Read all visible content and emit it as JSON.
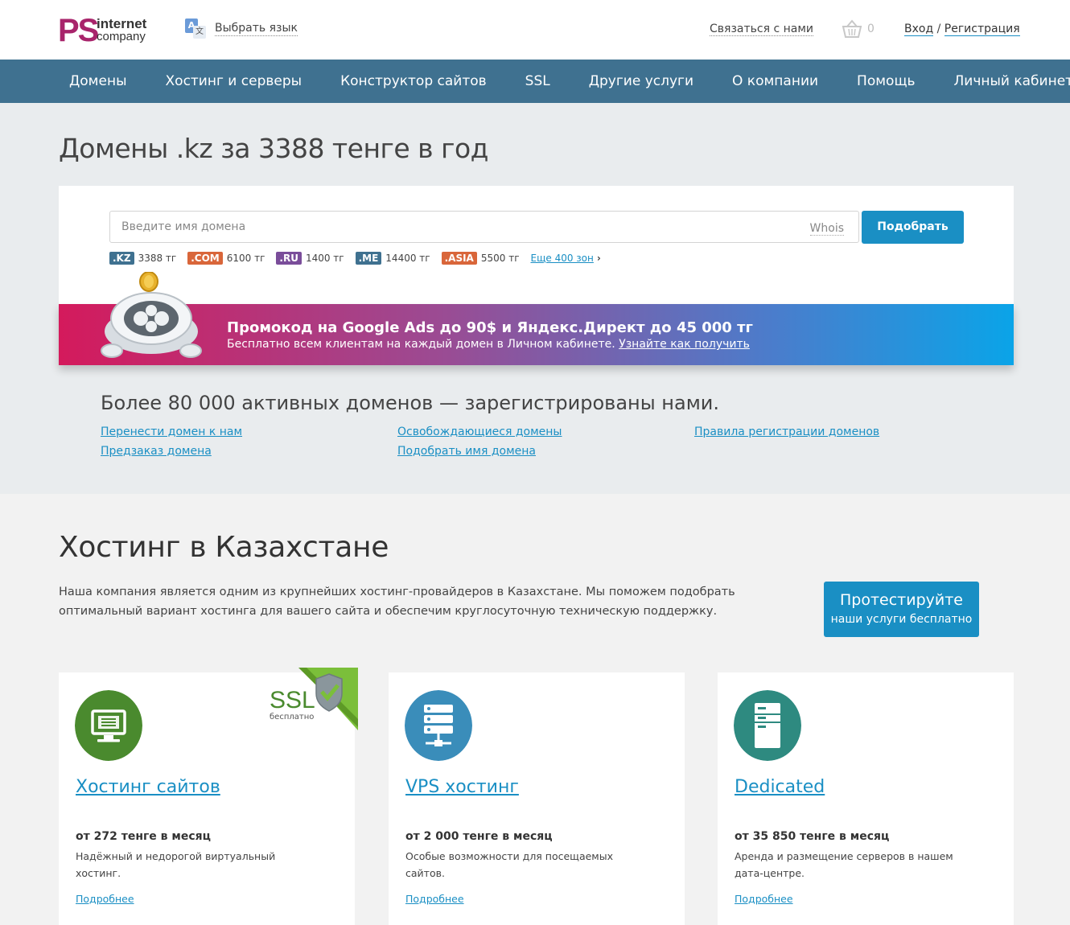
{
  "header": {
    "logo_ps": "PS",
    "logo_internet": "internet",
    "logo_company": "company",
    "language_label": "Выбрать язык",
    "contact_label": "Связаться с нами",
    "cart_count": "0",
    "login_label": "Вход",
    "auth_separator": "/",
    "register_label": "Регистрация"
  },
  "nav": {
    "items": [
      "Домены",
      "Хостинг и серверы",
      "Конструктор сайтов",
      "SSL",
      "Другие услуги",
      "О компании",
      "Помощь",
      "Личный кабинет"
    ]
  },
  "domains": {
    "title": "Домены .kz за 3388 тенге в год",
    "search_placeholder": "Введите имя домена",
    "whois_label": "Whois",
    "search_button": "Подобрать",
    "zones": [
      {
        "name": ".KZ",
        "price": "3388 тг",
        "color": "#3f7190"
      },
      {
        "name": ".COM",
        "price": "6100 тг",
        "color": "#d9663a"
      },
      {
        "name": ".RU",
        "price": "1400 тг",
        "color": "#7a4d9a"
      },
      {
        "name": ".ME",
        "price": "14400 тг",
        "color": "#3f7190"
      },
      {
        "name": ".ASIA",
        "price": "5500 тг",
        "color": "#d9663a"
      }
    ],
    "more_zones": "Еще 400 зон",
    "more_zones_arrow": "›",
    "promo_title": "Промокод на Google Ads до 90$ и Яндекс.Директ до 45 000 тг",
    "promo_text": "Бесплатно всем клиентам на каждый домен в Личном кабинете.",
    "promo_link": "Узнайте как получить",
    "count_text": "Более 80 000 активных доменов — зарегистрированы нами.",
    "links": {
      "transfer": "Перенести домен к нам",
      "preorder": "Предзаказ домена",
      "expiring": "Освобождающиеся домены",
      "pick": "Подобрать имя домена",
      "rules": "Правила регистрации доменов"
    }
  },
  "hosting": {
    "title": "Хостинг в Казахстане",
    "description": "Наша компания является одним из крупнейших хостинг-провайдеров в Казахстане. Мы поможем подобрать оптимальный вариант хостинга для вашего сайта и обеспечим круглосуточную техническую поддержку.",
    "test_button_line1": "Протестируйте",
    "test_button_line2": "наши услуги бесплатно",
    "ssl_label": "SSL",
    "ssl_sub": "бесплатно",
    "cards": [
      {
        "title": "Хостинг сайтов",
        "price": "от 272 тенге в месяц",
        "text": "Надёжный и недорогой виртуальный хостинг.",
        "more": "Подробнее",
        "icon_color": "#4a8a2e"
      },
      {
        "title": "VPS хостинг",
        "price": "от 2 000 тенге в месяц",
        "text": "Особые возможности для посещаемых сайтов.",
        "more": "Подробнее",
        "icon_color": "#3a8dba"
      },
      {
        "title": "Dedicated",
        "price": "от 35 850 тенге в месяц",
        "text": "Аренда и размещение серверов в нашем дата-центре.",
        "more": "Подробнее",
        "icon_color": "#2e8a80"
      }
    ]
  }
}
